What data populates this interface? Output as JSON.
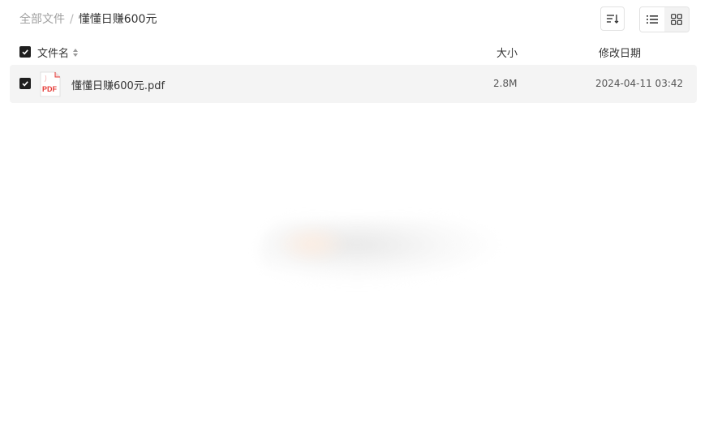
{
  "breadcrumb": {
    "root": "全部文件",
    "separator": "/",
    "current": "懂懂日赚600元"
  },
  "toolbar": {
    "sort_icon": "sort-lines-icon",
    "view_list_icon": "list-view-icon",
    "view_grid_icon": "grid-view-icon"
  },
  "table": {
    "headers": {
      "name": "文件名",
      "size": "大小",
      "date": "修改日期"
    },
    "rows": [
      {
        "name": "懂懂日赚600元.pdf",
        "size": "2.8M",
        "date": "2024-04-11 03:42",
        "icon": "pdf-file-icon",
        "icon_label": "PDF",
        "checked": true
      }
    ]
  },
  "colors": {
    "checkbox": "#1f1f1f",
    "row_bg": "#f4f4f4",
    "pdf_red": "#e53935"
  }
}
